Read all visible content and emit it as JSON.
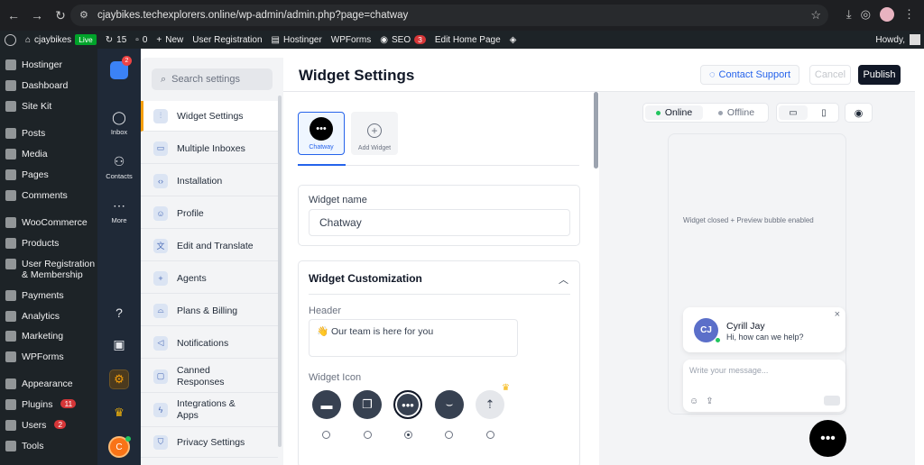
{
  "browser": {
    "url": "cjaybikes.techexplorers.online/wp-admin/admin.php?page=chatway"
  },
  "wp_admin_bar": {
    "site_name": "cjaybikes",
    "live_badge": "Live",
    "updates_count": "15",
    "comments_count": "0",
    "new_label": "New",
    "user_registration": "User Registration",
    "hostinger": "Hostinger",
    "wpforms": "WPForms",
    "seo_label": "SEO",
    "seo_count": "3",
    "edit_home": "Edit Home Page",
    "howdy": "Howdy,"
  },
  "wp_menu": [
    {
      "label": "Hostinger"
    },
    {
      "label": "Dashboard"
    },
    {
      "label": "Site Kit"
    },
    {
      "label": "Posts"
    },
    {
      "label": "Media"
    },
    {
      "label": "Pages"
    },
    {
      "label": "Comments"
    },
    {
      "label": "WooCommerce"
    },
    {
      "label": "Products"
    },
    {
      "label": "User Registration & Membership"
    },
    {
      "label": "Payments"
    },
    {
      "label": "Analytics"
    },
    {
      "label": "Marketing"
    },
    {
      "label": "WPForms"
    },
    {
      "label": "Appearance"
    },
    {
      "label": "Plugins",
      "count": "11"
    },
    {
      "label": "Users",
      "count": "2"
    },
    {
      "label": "Tools"
    }
  ],
  "rail": {
    "badge": "2",
    "inbox": "Inbox",
    "contacts": "Contacts",
    "more": "More",
    "user_initial": "C"
  },
  "settings_nav": {
    "search_placeholder": "Search settings",
    "items": [
      {
        "label": "Widget Settings"
      },
      {
        "label": "Multiple Inboxes"
      },
      {
        "label": "Installation"
      },
      {
        "label": "Profile"
      },
      {
        "label": "Edit and Translate"
      },
      {
        "label": "Agents"
      },
      {
        "label": "Plans & Billing"
      },
      {
        "label": "Notifications"
      },
      {
        "label": "Canned Responses"
      },
      {
        "label": "Integrations & Apps"
      },
      {
        "label": "Privacy Settings"
      }
    ]
  },
  "header": {
    "title": "Widget Settings",
    "contact_support": "Contact Support",
    "cancel": "Cancel",
    "publish": "Publish"
  },
  "widgets": {
    "selected": "Chatway",
    "add": "Add Widget"
  },
  "widget_name": {
    "label": "Widget name",
    "value": "Chatway"
  },
  "customization": {
    "title": "Widget Customization",
    "header_label": "Header",
    "header_value": "👋 Our team is here for you",
    "icon_label": "Widget Icon",
    "selected_icon_index": 2
  },
  "preview": {
    "online": "Online",
    "offline": "Offline",
    "closed_text": "Widget closed + Preview bubble enabled",
    "agent_initials": "CJ",
    "agent_name": "Cyrill Jay",
    "agent_message": "Hi, how can we help?",
    "compose_placeholder": "Write your message...",
    "colors": {
      "online": "#22c55e",
      "offline": "#9ca3af"
    }
  }
}
